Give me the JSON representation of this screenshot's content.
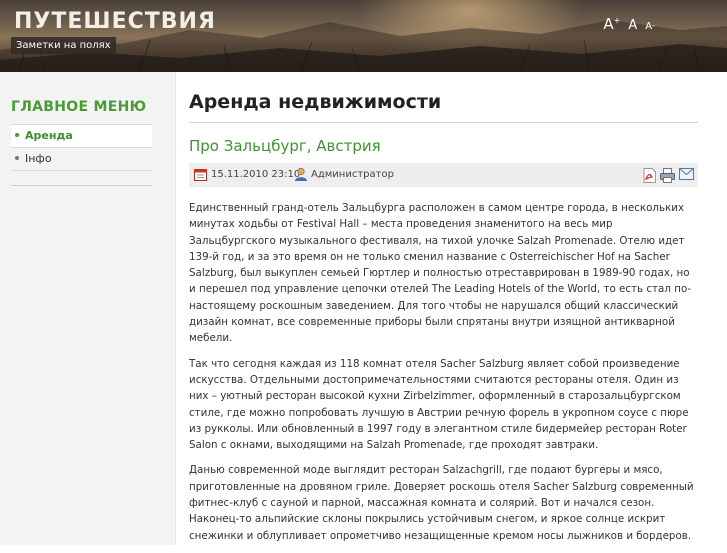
{
  "header": {
    "site_title": "ПУТЕШЕСТВИЯ",
    "site_description": "Заметки на полях",
    "font_controls": {
      "increase": "A",
      "reset": "A",
      "decrease": "A",
      "increase_mark": "+",
      "decrease_mark": "-"
    }
  },
  "sidebar": {
    "menu_title": "ГЛАВНОЕ МЕНЮ",
    "items": [
      {
        "label": "Аренда",
        "active": true
      },
      {
        "label": "Інфо",
        "active": false
      }
    ]
  },
  "content": {
    "page_title": "Аренда недвижимости",
    "article": {
      "title": "Про Зальцбург, Австрия",
      "date": "15.11.2010 23:10",
      "author": "Администратор",
      "tool_icons": [
        "pdf-icon",
        "print-icon",
        "email-icon"
      ],
      "paragraphs": [
        "Единственный гранд-отель Зальцбурга расположен в самом центре города, в нескольких минутах ходьбы от Festival Hall – места проведения знаменитого на весь мир Зальцбургского музыкального фестиваля, на тихой улочке Salzah Promenade. Отелю идет 139-й год, и за это время он не только сменил название с Osterreichischer Hof на Sacher Salzburg, был выкуплен семьей Гюртлер и полностью отреставрирован в 1989-90 годах, но и перешел под управление цепочки отелей The Leading Hotels of the World, то есть стал по-настоящему роскошным заведением. Для того чтобы не нарушался общий классический дизайн комнат, все современные приборы были спрятаны внутри изящной антикварной мебели.",
        "Так что сегодня каждая из 118 комнат отеля Sacher Salzburg являет собой произведение искусства. Отдельными достопримечательностями считаются рестораны отеля. Один из них – уютный ресторан высокой кухни Zirbelzimmer, оформленный в старозальцбургском стиле, где можно попробовать лучшую в Австрии речную форель в укропном соусе с пюре из рукколы. Или обновленный в 1997 году в элегантном стиле бидермейер ресторан Roter Salon с окнами, выходящими на Salzah Promenade, где проходят завтраки.",
        "Данью современной моде выглядит ресторан Salzachgrill, где подают бургеры и мясо, приготовленные на дровяном гриле. Доверяет роскошь отеля Sacher Salzburg современный фитнес-клуб с сауной и парной, массажная комната и солярий. Вот и начался сезон. Наконец-то альпийские склоны покрылись устойчивым снегом, и яркое солнце искрит снежинки и облупливает опрометчиво незащищенные кремом носы лыжников и бордеров."
      ]
    }
  },
  "colors": {
    "accent_green": "#4a9a35",
    "header_dark": "#2c2420",
    "sidebar_bg": "#f3f3f3",
    "meta_bg": "#eeeeee"
  }
}
